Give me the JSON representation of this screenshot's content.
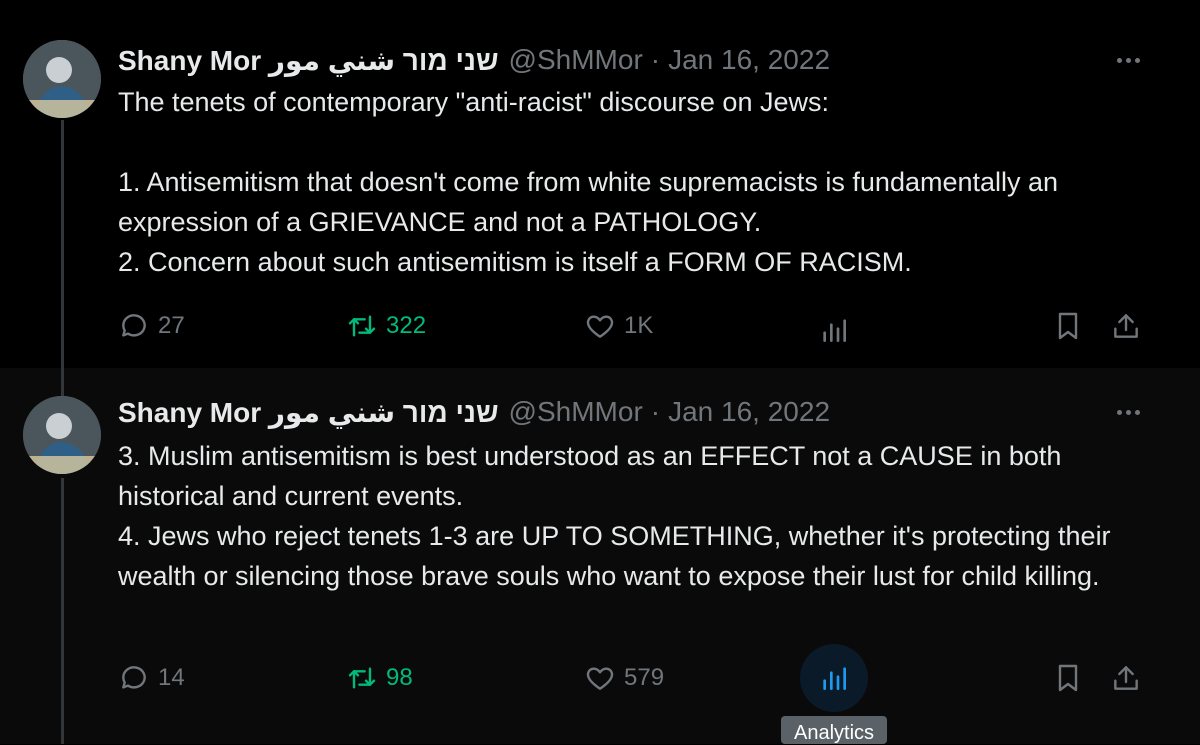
{
  "colors": {
    "background": "#000000",
    "text": "#e7e9ea",
    "muted": "#71767b",
    "retweet": "#00ba7c",
    "analytics_hover": "#1d9bf0"
  },
  "tweets": [
    {
      "author_name": "Shany Mor שני מור شني مور",
      "handle": "@ShMMor",
      "separator": "·",
      "date": "Jan 16, 2022",
      "text": "The tenets of contemporary \"anti-racist\" discourse on Jews:\n\n1. Antisemitism that doesn't come from white supremacists is fundamentally an expression of a GRIEVANCE and not a PATHOLOGY.\n2. Concern about such antisemitism is itself a FORM OF RACISM.",
      "replies": "27",
      "retweets": "322",
      "likes": "1K",
      "icons": [
        "reply-icon",
        "retweet-icon",
        "like-icon",
        "analytics-icon",
        "bookmark-icon",
        "share-icon",
        "more-icon"
      ]
    },
    {
      "author_name": "Shany Mor שני מור شني مور",
      "handle": "@ShMMor",
      "separator": "·",
      "date": "Jan 16, 2022",
      "text": "3. Muslim antisemitism is best understood as an EFFECT not a CAUSE in both historical and current events.\n4. Jews who reject tenets 1-3 are UP TO SOMETHING, whether it's protecting their wealth or silencing those brave souls who want to expose their lust for child killing.",
      "replies": "14",
      "retweets": "98",
      "likes": "579",
      "icons": [
        "reply-icon",
        "retweet-icon",
        "like-icon",
        "analytics-icon",
        "bookmark-icon",
        "share-icon",
        "more-icon"
      ]
    }
  ],
  "tooltip": {
    "label": "Analytics"
  }
}
